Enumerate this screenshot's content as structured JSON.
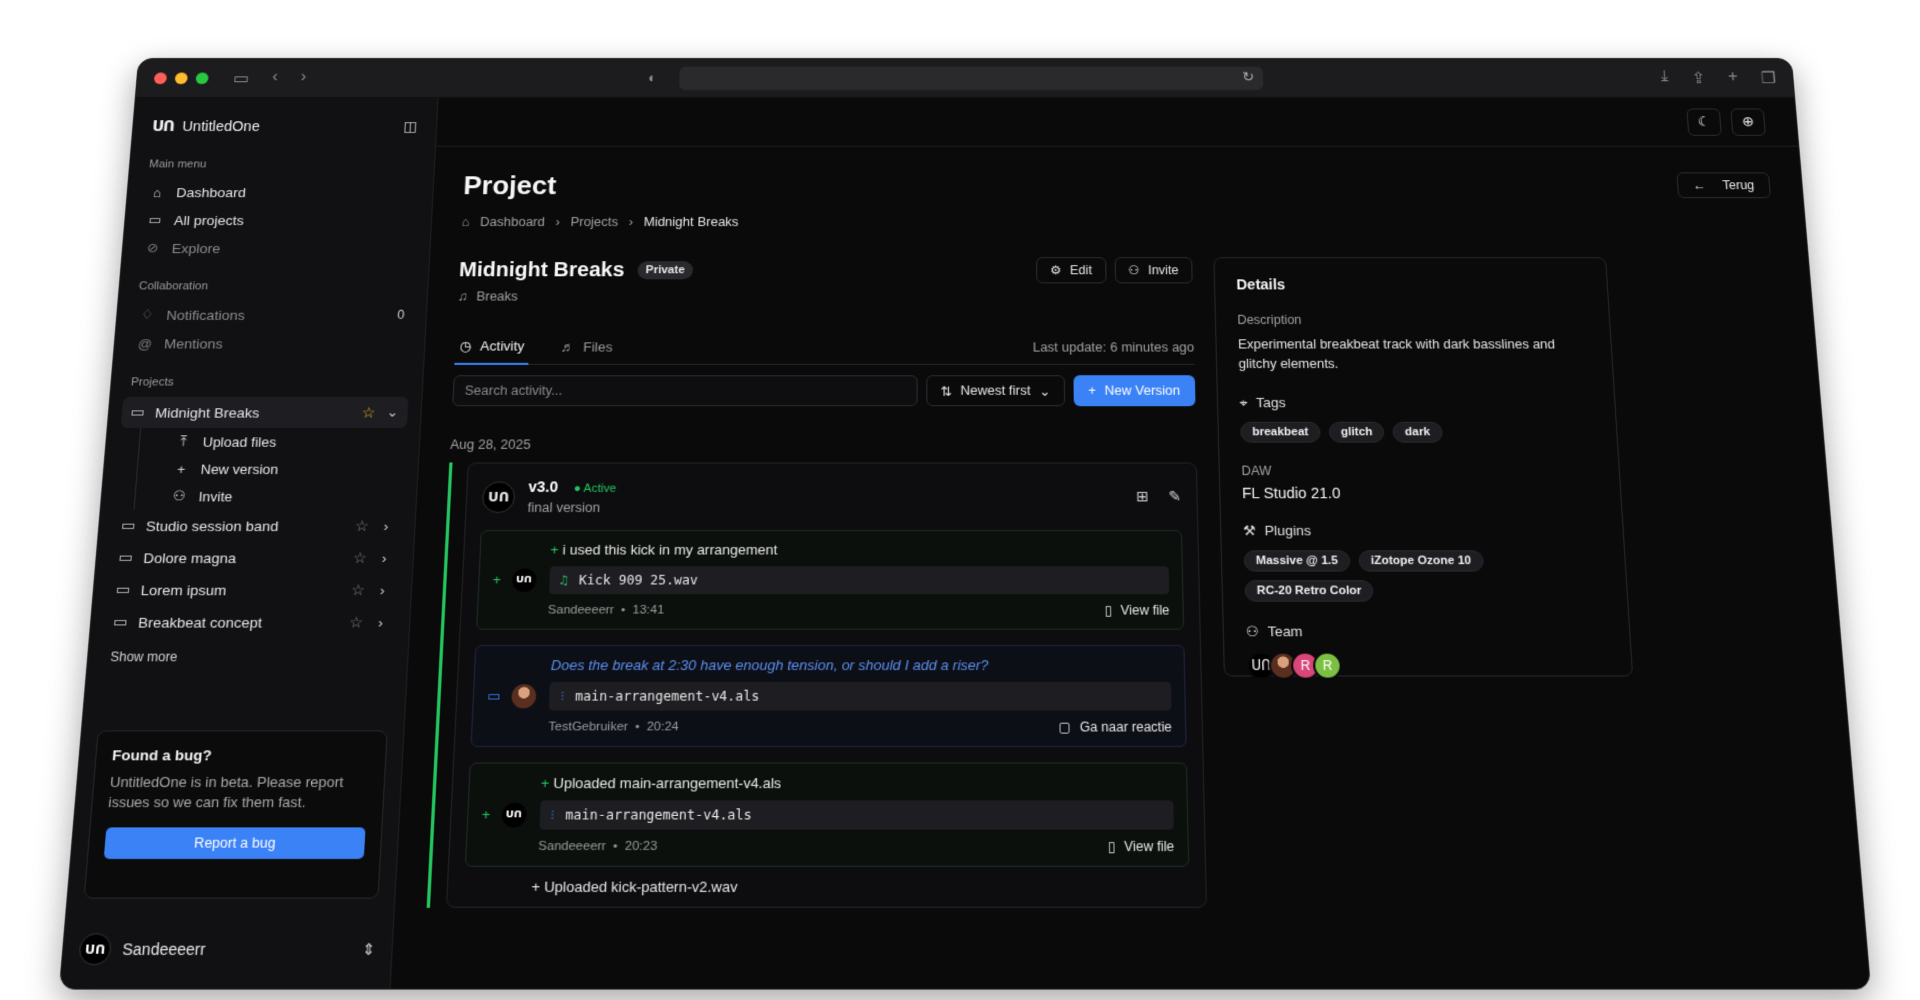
{
  "app": {
    "name": "UntitledOne"
  },
  "sidebar": {
    "main_menu_label": "Main menu",
    "main_menu": [
      {
        "label": "Dashboard",
        "icon": "home-icon"
      },
      {
        "label": "All projects",
        "icon": "folder-icon"
      },
      {
        "label": "Explore",
        "icon": "compass-icon"
      }
    ],
    "collab_label": "Collaboration",
    "notifications": {
      "label": "Notifications",
      "count": "0"
    },
    "mentions": {
      "label": "Mentions"
    },
    "projects_label": "Projects",
    "projects": [
      {
        "label": "Midnight Breaks",
        "active": true
      },
      {
        "label": "Studio session band"
      },
      {
        "label": "Dolore magna"
      },
      {
        "label": "Lorem ipsum"
      },
      {
        "label": "Breakbeat concept"
      }
    ],
    "sub_items": [
      "Upload files",
      "New version",
      "Invite"
    ],
    "show_more": "Show more",
    "bug": {
      "title": "Found a bug?",
      "text": "UntitledOne is in beta. Please report issues so we can fix them fast.",
      "button": "Report a bug"
    },
    "user": {
      "name": "Sandeeeerr"
    }
  },
  "page": {
    "title": "Project",
    "back": "Terug",
    "breadcrumb": [
      "Dashboard",
      "Projects",
      "Midnight Breaks"
    ]
  },
  "project": {
    "name": "Midnight Breaks",
    "visibility": "Private",
    "genre": "Breaks",
    "edit": "Edit",
    "invite": "Invite",
    "tabs": [
      "Activity",
      "Files"
    ],
    "last_update": "Last update: 6 minutes ago",
    "search_placeholder": "Search activity...",
    "sort": "Newest first",
    "new_version": "New Version",
    "date": "Aug 28, 2025",
    "version": {
      "title": "v3.0",
      "status": "Active",
      "subtitle": "final version",
      "items": [
        {
          "type": "upload",
          "title": "i used this kick in my arrangement",
          "file": "Kick 909 25.wav",
          "user": "Sandeeeerr",
          "time": "13:41",
          "link": "View file"
        },
        {
          "type": "comment",
          "title": "Does the break at 2:30 have enough tension, or should I add a riser?",
          "file": "main-arrangement-v4.als",
          "user": "TestGebruiker",
          "time": "20:24",
          "link": "Ga naar reactie"
        },
        {
          "type": "upload",
          "title": "Uploaded main-arrangement-v4.als",
          "file": "main-arrangement-v4.als",
          "user": "Sandeeeerr",
          "time": "20:23",
          "link": "View file"
        }
      ],
      "peek": "Uploaded kick-pattern-v2.wav"
    }
  },
  "details": {
    "title": "Details",
    "description_label": "Description",
    "description": "Experimental breakbeat track with dark basslines and glitchy elements.",
    "tags_label": "Tags",
    "tags": [
      "breakbeat",
      "glitch",
      "dark"
    ],
    "daw_label": "DAW",
    "daw": "FL Studio 21.0",
    "plugins_label": "Plugins",
    "plugins": [
      "Massive @ 1.5",
      "iZotope Ozone 10",
      "RC-20 Retro Color"
    ],
    "team_label": "Team",
    "team": [
      {
        "initial": "",
        "color": "#000000"
      },
      {
        "initial": "",
        "color": "#6b3a2a"
      },
      {
        "initial": "R",
        "color": "#d9467a"
      },
      {
        "initial": "R",
        "color": "#7cc043"
      }
    ]
  }
}
